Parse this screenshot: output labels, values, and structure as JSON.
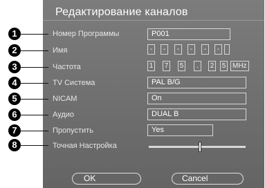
{
  "title": "Редактирование каналов",
  "items": [
    {
      "num": "1",
      "label": "Номер Программы",
      "value": "P001"
    },
    {
      "num": "2",
      "label": "Имя",
      "value": "- - - - - -"
    },
    {
      "num": "3",
      "label": "Частота",
      "value": "175.25 MHz"
    },
    {
      "num": "4",
      "label": "TV Система",
      "value": "PAL B/G"
    },
    {
      "num": "5",
      "label": "NICAM",
      "value": "On"
    },
    {
      "num": "6",
      "label": "Аудио",
      "value": "DUAL B"
    },
    {
      "num": "7",
      "label": "Пропустить",
      "value": "Yes"
    },
    {
      "num": "8",
      "label": "Точная Настройка",
      "value": ""
    }
  ],
  "name_chars": [
    "-",
    "-",
    "-",
    "-",
    "-",
    "-"
  ],
  "freq_chars": [
    "1",
    "7",
    "5",
    ".",
    "2",
    "5"
  ],
  "freq_unit": "MHz",
  "fine_tune_level": 0.53,
  "buttons": {
    "ok": "OK",
    "cancel": "Cancel"
  },
  "colors": {
    "panel": "#707070",
    "bullet": "#000000",
    "text": "#ffffff"
  }
}
